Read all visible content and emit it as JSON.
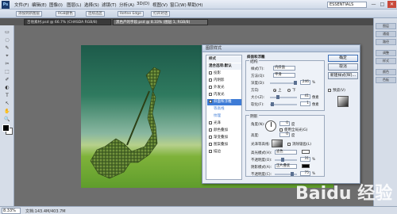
{
  "app": {
    "logo": "Ps"
  },
  "menu": [
    "文件(F)",
    "编辑(E)",
    "图像(I)",
    "图层(L)",
    "选择(S)",
    "滤镜(T)",
    "分析(A)",
    "3D(D)",
    "视图(V)",
    "窗口(W)",
    "帮助(H)"
  ],
  "workspace": "ESSENTIALS",
  "window_controls": [
    "—",
    "□",
    "✕"
  ],
  "options_bar": {
    "b1": "添加到新图层",
    "b2": "RGB颜色",
    "b3": "连续选区",
    "b4": "Refine Edge",
    "b5": "打开对话"
  },
  "doc_tabs": [
    "吉他素材.psd @ 66.7% (CHASDA RGB/8)",
    "黑色产的字段.psd @ 8.33% (图层 1, RGB/8)"
  ],
  "tools": [
    "▭",
    "◌",
    "✎",
    "⌖",
    "✂",
    "⬚",
    "✐",
    "◐",
    "T",
    "↖",
    "✋",
    "🔍"
  ],
  "status": {
    "zoom": "8.33%",
    "doc": "文档:143.4M/403.7M"
  },
  "watermark": "Baidu 经验",
  "right_panels": [
    "图层",
    "通道",
    "路径",
    "调整",
    "样式",
    "颜色",
    "色板"
  ],
  "dialog": {
    "title": "图层样式",
    "styles": [
      {
        "label": "样式",
        "type": "hdr"
      },
      {
        "label": "混合选项:默认",
        "type": "hdr"
      },
      {
        "label": "投影",
        "type": "cb"
      },
      {
        "label": "内阴影",
        "type": "cb"
      },
      {
        "label": "外发光",
        "type": "cb"
      },
      {
        "label": "内发光",
        "type": "cb"
      },
      {
        "label": "斜面和浮雕",
        "type": "sel"
      },
      {
        "label": "等高线",
        "type": "sub"
      },
      {
        "label": "纹理",
        "type": "sub"
      },
      {
        "label": "光泽",
        "type": "cb"
      },
      {
        "label": "颜色叠加",
        "type": "cb"
      },
      {
        "label": "渐变叠加",
        "type": "cb"
      },
      {
        "label": "图案叠加",
        "type": "cb"
      },
      {
        "label": "描边",
        "type": "cb"
      }
    ],
    "bevel": {
      "title": "斜面和浮雕",
      "structure": "结构",
      "style_lbl": "样式(T):",
      "style_val": "内斜面",
      "tech_lbl": "方法(Q):",
      "tech_val": "平滑",
      "depth_lbl": "深度(D):",
      "depth_val": "246",
      "depth_unit": "%",
      "dir_lbl": "方向:",
      "dir_up": "上",
      "dir_down": "下",
      "size_lbl": "大小(Z):",
      "size_val": "41",
      "size_unit": "像素",
      "soften_lbl": "软化(F):",
      "soften_val": "1",
      "soften_unit": "像素"
    },
    "shading": {
      "title": "阴影",
      "angle_lbl": "角度(N):",
      "angle_val": "0",
      "angle_unit": "度",
      "global_lbl": "使用全局光(G)",
      "alt_lbl": "高度:",
      "alt_val": "0",
      "alt_unit": "度",
      "gloss_lbl": "光泽等高线:",
      "antialias_lbl": "消除锯齿(L)",
      "hl_lbl": "高光模式(H):",
      "hl_val": "滤色",
      "hl_op_lbl": "不透明度(O):",
      "hl_op_val": "31",
      "hl_op_unit": "%",
      "sh_lbl": "阴影模式(A):",
      "sh_val": "正片叠底",
      "sh_op_lbl": "不透明度(C):",
      "sh_op_val": "75",
      "sh_op_unit": "%"
    },
    "buttons": {
      "ok": "确定",
      "cancel": "取消",
      "new_style": "新建样式(W)...",
      "preview": "预览(V)"
    },
    "colors": {
      "highlight": "#ffffff",
      "shadow": "#000000"
    }
  }
}
